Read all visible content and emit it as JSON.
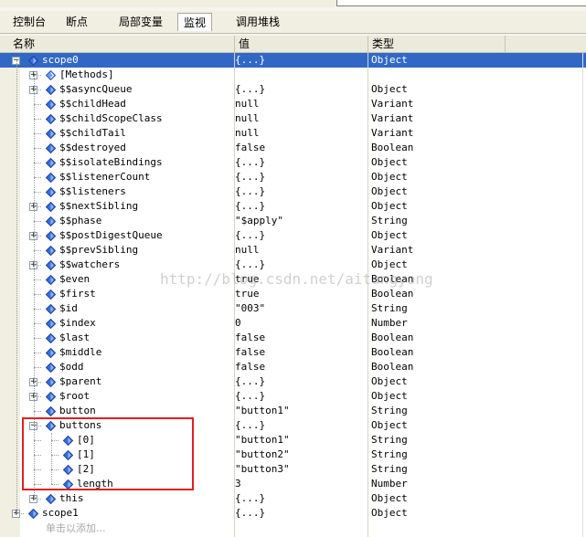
{
  "tabs": [
    {
      "label": "控制台",
      "active": false
    },
    {
      "label": "断点",
      "active": false
    },
    {
      "label": "局部变量",
      "active": false
    },
    {
      "label": "监视",
      "active": true
    },
    {
      "label": "调用堆栈",
      "active": false
    }
  ],
  "columns": {
    "name": "名称",
    "value": "值",
    "type": "类型"
  },
  "rows": [
    {
      "name": "scope0",
      "value": "{...}",
      "type": "Object",
      "level": 0,
      "toggle": "-",
      "selected": true
    },
    {
      "name": "[Methods]",
      "value": "",
      "type": "",
      "level": 1,
      "toggle": "+",
      "icon": "methods"
    },
    {
      "name": "$$asyncQueue",
      "value": "{...}",
      "type": "Object",
      "level": 1,
      "toggle": "+"
    },
    {
      "name": "$$childHead",
      "value": "null",
      "type": "Variant",
      "level": 1
    },
    {
      "name": "$$childScopeClass",
      "value": "null",
      "type": "Variant",
      "level": 1
    },
    {
      "name": "$$childTail",
      "value": "null",
      "type": "Variant",
      "level": 1
    },
    {
      "name": "$$destroyed",
      "value": "false",
      "type": "Boolean",
      "level": 1
    },
    {
      "name": "$$isolateBindings",
      "value": "{...}",
      "type": "Object",
      "level": 1
    },
    {
      "name": "$$listenerCount",
      "value": "{...}",
      "type": "Object",
      "level": 1
    },
    {
      "name": "$$listeners",
      "value": "{...}",
      "type": "Object",
      "level": 1
    },
    {
      "name": "$$nextSibling",
      "value": "{...}",
      "type": "Object",
      "level": 1,
      "toggle": "+"
    },
    {
      "name": "$$phase",
      "value": "\"$apply\"",
      "type": "String",
      "level": 1
    },
    {
      "name": "$$postDigestQueue",
      "value": "{...}",
      "type": "Object",
      "level": 1,
      "toggle": "+"
    },
    {
      "name": "$$prevSibling",
      "value": "null",
      "type": "Variant",
      "level": 1
    },
    {
      "name": "$$watchers",
      "value": "{...}",
      "type": "Object",
      "level": 1,
      "toggle": "+"
    },
    {
      "name": "$even",
      "value": "true",
      "type": "Boolean",
      "level": 1
    },
    {
      "name": "$first",
      "value": "true",
      "type": "Boolean",
      "level": 1
    },
    {
      "name": "$id",
      "value": "\"003\"",
      "type": "String",
      "level": 1
    },
    {
      "name": "$index",
      "value": "0",
      "type": "Number",
      "level": 1
    },
    {
      "name": "$last",
      "value": "false",
      "type": "Boolean",
      "level": 1
    },
    {
      "name": "$middle",
      "value": "false",
      "type": "Boolean",
      "level": 1
    },
    {
      "name": "$odd",
      "value": "false",
      "type": "Boolean",
      "level": 1
    },
    {
      "name": "$parent",
      "value": "{...}",
      "type": "Object",
      "level": 1,
      "toggle": "+"
    },
    {
      "name": "$root",
      "value": "{...}",
      "type": "Object",
      "level": 1,
      "toggle": "+"
    },
    {
      "name": "button",
      "value": "\"button1\"",
      "type": "String",
      "level": 1
    },
    {
      "name": "buttons",
      "value": "{...}",
      "type": "Object",
      "level": 1,
      "toggle": "-"
    },
    {
      "name": "[0]",
      "value": "\"button1\"",
      "type": "String",
      "level": 2
    },
    {
      "name": "[1]",
      "value": "\"button2\"",
      "type": "String",
      "level": 2
    },
    {
      "name": "[2]",
      "value": "\"button3\"",
      "type": "String",
      "level": 2
    },
    {
      "name": "length",
      "value": "3",
      "type": "Number",
      "level": 2
    },
    {
      "name": "this",
      "value": "{...}",
      "type": "Object",
      "level": 1,
      "toggle": "+"
    },
    {
      "name": "scope1",
      "value": "{...}",
      "type": "Object",
      "level": 0,
      "toggle": "+"
    }
  ],
  "add_hint": "单击以添加...",
  "watermark": "http://blog.csdn.net/aitangyong",
  "colors": {
    "selection": "#3168c6",
    "highlight_box": "#e02020",
    "icon": "#3a6fd8"
  }
}
